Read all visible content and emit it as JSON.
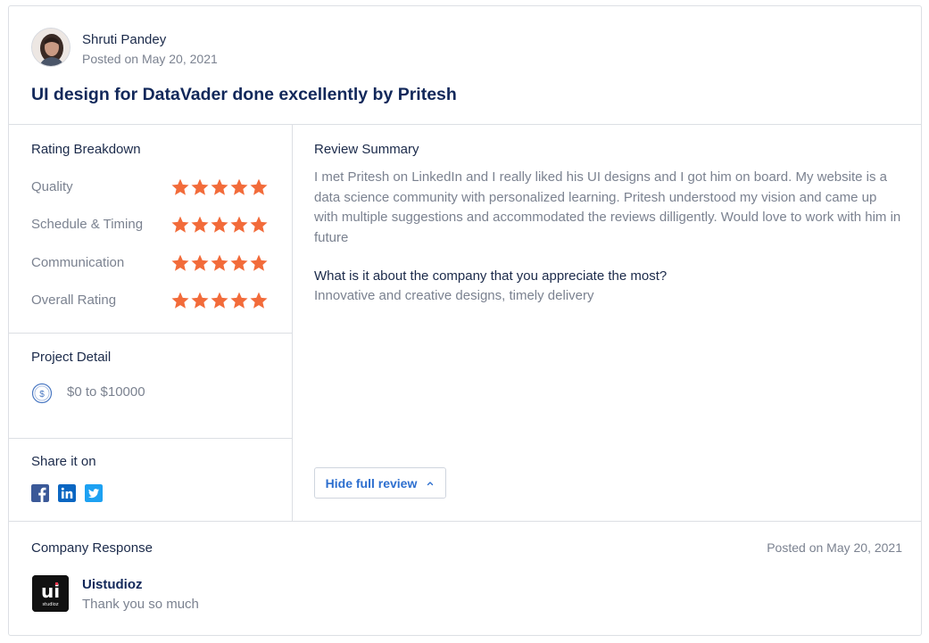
{
  "review": {
    "reviewer_name": "Shruti Pandey",
    "posted_date": "Posted on May 20, 2021",
    "title": "UI design for DataVader done excellently by Pritesh"
  },
  "rating_breakdown": {
    "heading": "Rating Breakdown",
    "items": [
      {
        "label": "Quality",
        "stars": 5
      },
      {
        "label": "Schedule & Timing",
        "stars": 5
      },
      {
        "label": "Communication",
        "stars": 5
      },
      {
        "label": "Overall Rating",
        "stars": 5
      }
    ],
    "star_color": "#f26b3a"
  },
  "project_detail": {
    "heading": "Project Detail",
    "icon": "dollar-coin-icon",
    "budget": "$0 to $10000"
  },
  "share": {
    "heading": "Share it on",
    "icons": [
      "facebook-icon",
      "linkedin-icon",
      "twitter-icon"
    ]
  },
  "summary": {
    "heading": "Review Summary",
    "body": "I met Pritesh on LinkedIn and I really liked his UI designs and I got him on board. My website is a data science community with personalized learning. Pritesh understood my vision and came up with multiple suggestions and accommodated the reviews dilligently. Would love to work with him in future",
    "question": "What is it about the company that you appreciate the most?",
    "answer": "Innovative and creative designs, timely delivery",
    "hide_button": "Hide full review"
  },
  "company_response": {
    "heading": "Company Response",
    "posted_date": "Posted on May 20, 2021",
    "company_name": "Uistudioz",
    "logo_text": "ui",
    "logo_subtext": "studioz",
    "message": "Thank you so much"
  },
  "colors": {
    "accent_blue": "#2d6fcf",
    "facebook": "#3b5998",
    "linkedin": "#0a66c2",
    "twitter": "#1da1f2"
  }
}
